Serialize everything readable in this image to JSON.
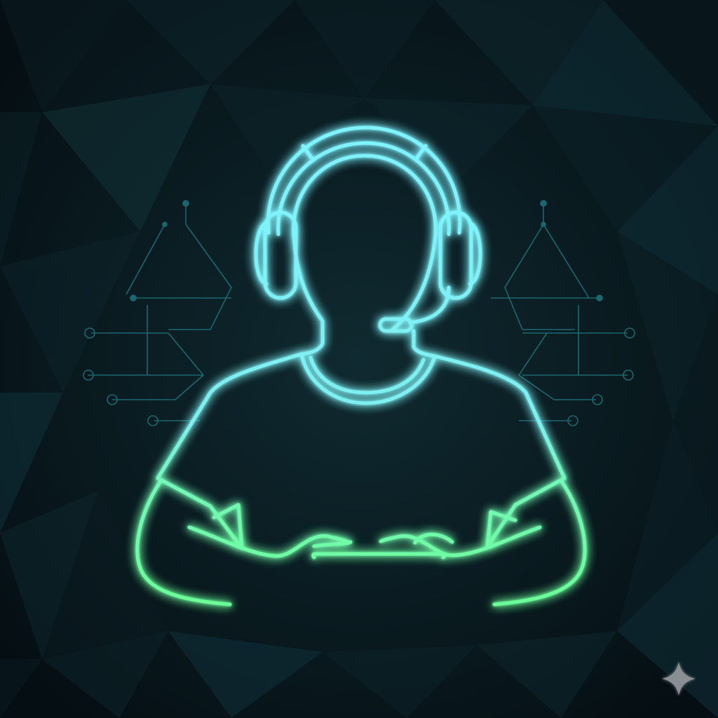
{
  "scene": {
    "subject": "headset-gamer-neon-avatar",
    "style": "neon outline on dark low-poly background"
  },
  "colors": {
    "background_dark": "#07141a",
    "background_facet_light": "#123237",
    "background_facet_mid": "#0d2329",
    "neon_cyan": "#7ff3ff",
    "neon_green": "#6bff96",
    "circuit_lines": "#1f6f7a",
    "sparkle": "#8a8f93"
  },
  "icons": {
    "avatar": "headset-person-icon",
    "corner_mark": "sparkle-icon"
  }
}
